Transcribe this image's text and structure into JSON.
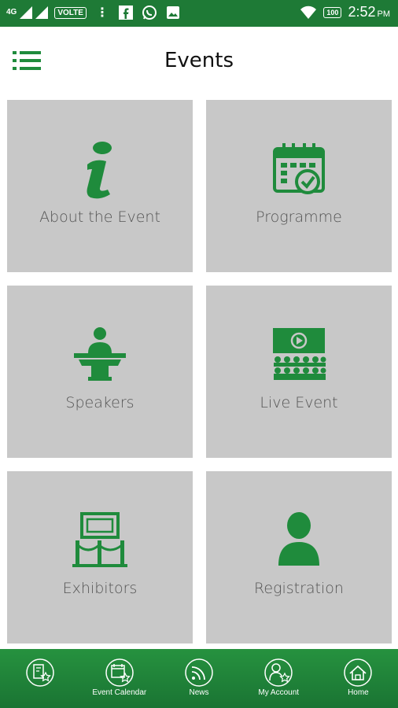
{
  "status_bar": {
    "network": "4G",
    "volte": "VOLTE",
    "battery": "100",
    "time": "2:52",
    "ampm": "PM"
  },
  "header": {
    "title": "Events",
    "menu_icon": "list-menu-icon"
  },
  "tiles": [
    {
      "label": "About the Event",
      "icon": "info-icon"
    },
    {
      "label": "Programme",
      "icon": "calendar-check-icon"
    },
    {
      "label": "Speakers",
      "icon": "speaker-podium-icon"
    },
    {
      "label": "Live Event",
      "icon": "live-screen-audience-icon"
    },
    {
      "label": "Exhibitors",
      "icon": "exhibit-frame-icon"
    },
    {
      "label": "Registration",
      "icon": "person-icon"
    }
  ],
  "bottom_nav": [
    {
      "label": "",
      "icon": "favorite-document-icon"
    },
    {
      "label": "Event Calendar",
      "icon": "calendar-star-icon"
    },
    {
      "label": "News",
      "icon": "rss-icon"
    },
    {
      "label": "My Account",
      "icon": "account-star-icon"
    },
    {
      "label": "Home",
      "icon": "home-icon"
    }
  ],
  "colors": {
    "brand_green": "#1e7a36",
    "icon_green": "#1f8b3c",
    "tile_gray": "#c8c8c8"
  }
}
